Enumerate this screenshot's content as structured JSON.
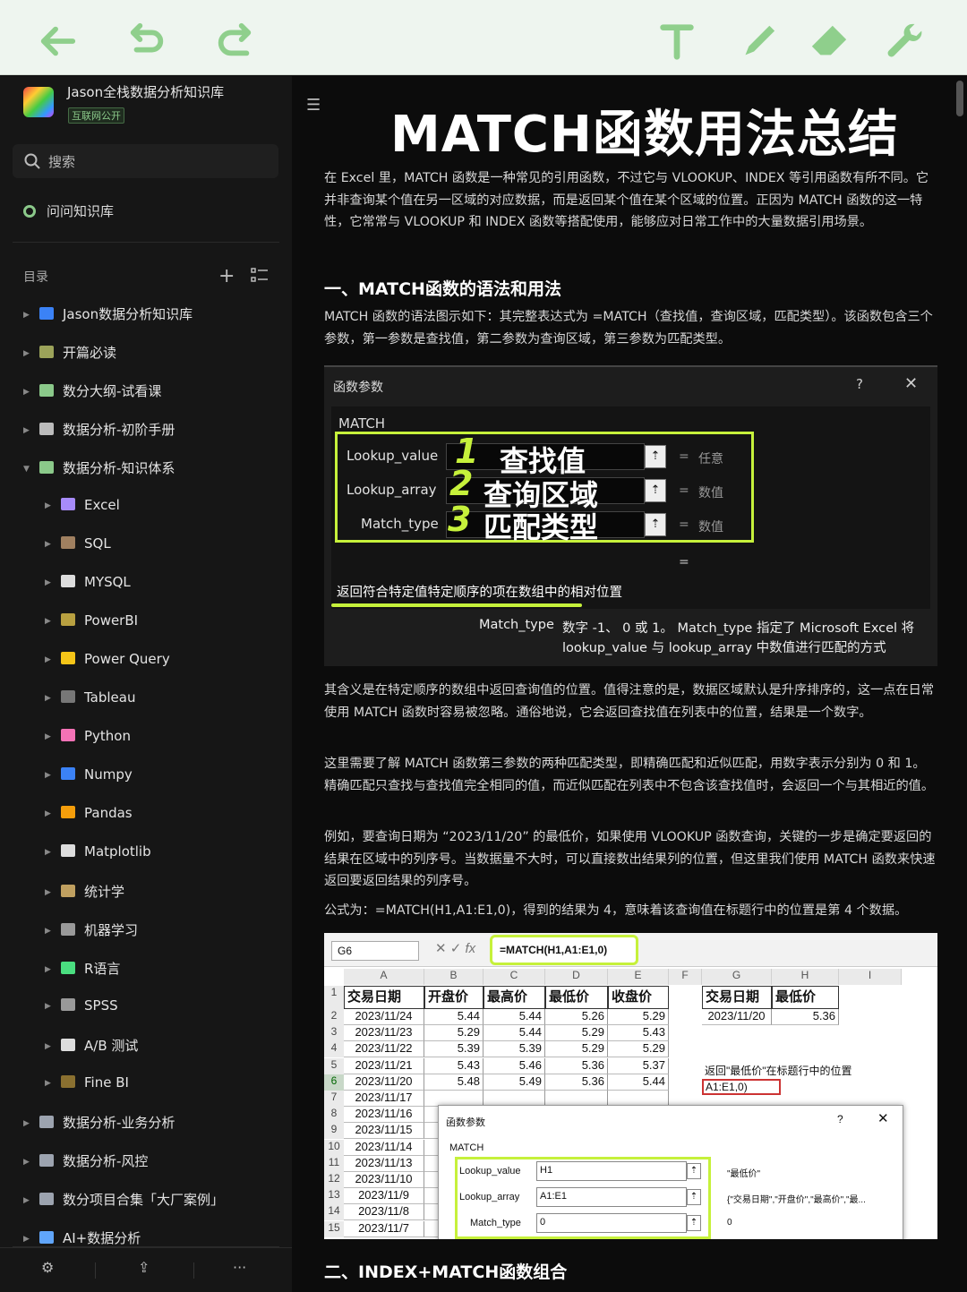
{
  "toolbar": {
    "icons": [
      "back-arrow-icon",
      "undo-icon",
      "redo-icon",
      "text-tool-icon",
      "pen-icon",
      "eraser-icon",
      "wrench-icon"
    ]
  },
  "sidebar": {
    "kb_title": "Jason全栈数据分析知识库",
    "kb_tag": "互联网公开",
    "search_label": "搜索",
    "ask_label": "问问知识库",
    "toc_label": "目录",
    "items": [
      {
        "label": "Jason数据分析知识库",
        "level": 0,
        "color": "#3b82f6"
      },
      {
        "label": "开篇必读",
        "level": 0,
        "color": "#9ca35a"
      },
      {
        "label": "数分大纲-试看课",
        "level": 0,
        "color": "#8bc98a"
      },
      {
        "label": "数据分析-初阶手册",
        "level": 0,
        "color": "#bbbbbb"
      },
      {
        "label": "数据分析-知识体系",
        "level": 0,
        "color": "#8bc98a",
        "expanded": true
      },
      {
        "label": "Excel",
        "level": 1,
        "color": "#a78bfa"
      },
      {
        "label": "SQL",
        "level": 1,
        "color": "#a08060"
      },
      {
        "label": "MYSQL",
        "level": 1,
        "color": "#dddddd"
      },
      {
        "label": "PowerBI",
        "level": 1,
        "color": "#b8a040"
      },
      {
        "label": "Power Query",
        "level": 1,
        "color": "#f5c518"
      },
      {
        "label": "Tableau",
        "level": 1,
        "color": "#777777"
      },
      {
        "label": "Python",
        "level": 1,
        "color": "#f472b6"
      },
      {
        "label": "Numpy",
        "level": 1,
        "color": "#3b82f6"
      },
      {
        "label": "Pandas",
        "level": 1,
        "color": "#f59e0b"
      },
      {
        "label": "Matplotlib",
        "level": 1,
        "color": "#dddddd"
      },
      {
        "label": "统计学",
        "level": 1,
        "color": "#c0a060"
      },
      {
        "label": "机器学习",
        "level": 1,
        "color": "#999999"
      },
      {
        "label": "R语言",
        "level": 1,
        "color": "#4ade80"
      },
      {
        "label": "SPSS",
        "level": 1,
        "color": "#999999"
      },
      {
        "label": "A/B 测试",
        "level": 1,
        "color": "#dddddd"
      },
      {
        "label": "Fine BI",
        "level": 1,
        "color": "#8a7030"
      },
      {
        "label": "数据分析-业务分析",
        "level": 0,
        "color": "#9ca3af"
      },
      {
        "label": "数据分析-风控",
        "level": 0,
        "color": "#9ca3af"
      },
      {
        "label": "数分项目合集「大厂案例」",
        "level": 0,
        "color": "#9ca3af"
      },
      {
        "label": "AI+数据分析",
        "level": 0,
        "color": "#60a5fa"
      }
    ],
    "bottom": {
      "more": "···"
    }
  },
  "doc": {
    "title": "MATCH函数用法总结",
    "intro": "在 Excel 里，MATCH 函数是一种常见的引用函数，不过它与 VLOOKUP、INDEX 等引用函数有所不同。它并非查询某个值在另一区域的对应数据，而是返回某个值在某个区域的位置。正因为 MATCH 函数的这一特性，它常常与 VLOOKUP 和 INDEX 函数等搭配使用，能够应对日常工作中的大量数据引用场景。",
    "h2_1": "一、MATCH函数的语法和用法",
    "syntax": "MATCH 函数的语法图示如下：其完整表达式为 =MATCH（查找值，查询区域，匹配类型）。该函数包含三个参数，第一参数是查找值，第二参数为查询区域，第三参数为匹配类型。",
    "dialog": {
      "title": "函数参数",
      "help": "?",
      "close": "✕",
      "fn": "MATCH",
      "args": [
        {
          "name": "Lookup_value",
          "annot": "查找值",
          "num": "1",
          "result": "任意"
        },
        {
          "name": "Lookup_array",
          "annot": "查询区域",
          "num": "2",
          "result": "数值"
        },
        {
          "name": "Match_type",
          "annot": "匹配类型",
          "num": "3",
          "result": "数值"
        }
      ],
      "eq": "=",
      "returns": "返回符合特定值特定顺序的项在数组中的相对位置",
      "param_name": "Match_type",
      "param_desc1": "数字 -1、 0 或 1。 Match_type 指定了 Microsoft Excel 将",
      "param_desc2": "lookup_value 与 lookup_array 中数值进行匹配的方式"
    },
    "p2": "其含义是在特定顺序的数组中返回查询值的位置。值得注意的是，数据区域默认是升序排序的，这一点在日常使用 MATCH 函数时容易被忽略。通俗地说，它会返回查找值在列表中的位置，结果是一个数字。",
    "p3": "这里需要了解 MATCH 函数第三参数的两种匹配类型，即精确匹配和近似匹配，用数字表示分别为 0 和 1。精确匹配只查找与查找值完全相同的值，而近似匹配在列表中不包含该查找值时，会返回一个与其相近的值。",
    "p4": "例如，要查询日期为 “2023/11/20” 的最低价，如果使用 VLOOKUP 函数查询，关键的一步是确定要返回的结果在区域中的列序号。当数据量不大时，可以直接数出结果列的位置，但这里我们使用 MATCH 函数来快速返回要返回结果的列序号。",
    "p5": "公式为：=MATCH(H1,A1:E1,0)，得到的结果为 4，意味着该查询值在标题行中的位置是第 4 个数据。",
    "h2_2": "二、INDEX+MATCH函数组合"
  },
  "sheet": {
    "namebox": "G6",
    "formula": "=MATCH(H1,A1:E1,0)",
    "cols": [
      "A",
      "B",
      "C",
      "D",
      "E",
      "F",
      "G",
      "H",
      "I"
    ],
    "headers": [
      "交易日期",
      "开盘价",
      "最高价",
      "最低价",
      "收盘价"
    ],
    "rows": [
      [
        "2023/11/24",
        "5.44",
        "5.44",
        "5.26",
        "5.29"
      ],
      [
        "2023/11/23",
        "5.29",
        "5.44",
        "5.29",
        "5.43"
      ],
      [
        "2023/11/22",
        "5.39",
        "5.39",
        "5.29",
        "5.29"
      ],
      [
        "2023/11/21",
        "5.43",
        "5.46",
        "5.36",
        "5.37"
      ],
      [
        "2023/11/20",
        "5.48",
        "5.49",
        "5.36",
        "5.44"
      ],
      [
        "2023/11/17",
        "",
        "",
        "",
        ""
      ],
      [
        "2023/11/16",
        "",
        "",
        "",
        ""
      ],
      [
        "2023/11/15",
        "",
        "",
        "",
        ""
      ],
      [
        "2023/11/14",
        "",
        "",
        "",
        ""
      ],
      [
        "2023/11/13",
        "",
        "",
        "",
        ""
      ],
      [
        "2023/11/10",
        "",
        "",
        "",
        ""
      ],
      [
        "2023/11/9",
        "",
        "",
        "",
        ""
      ],
      [
        "2023/11/8",
        "",
        "",
        "",
        ""
      ],
      [
        "2023/11/7",
        "",
        "",
        "",
        ""
      ]
    ],
    "lookup_headers": [
      "交易日期",
      "最低价"
    ],
    "lookup_date": "2023/11/20",
    "lookup_result": "5.36",
    "note": "返回\"最低价\"在标题行中的位置",
    "edit_cell": "A1:E1,0)",
    "dlg": {
      "title": "函数参数",
      "fn": "MATCH",
      "help": "?",
      "close": "✕",
      "args": [
        {
          "name": "Lookup_value",
          "value": "H1",
          "result": "\"最低价\""
        },
        {
          "name": "Lookup_array",
          "value": "A1:E1",
          "result": "{\"交易日期\",\"开盘价\",\"最高价\",\"最..."
        },
        {
          "name": "Match_type",
          "value": "0",
          "result": "0"
        }
      ]
    }
  },
  "colors": {
    "accent": "#c6f13b",
    "toolbar_icon": "#8fcf8c"
  }
}
